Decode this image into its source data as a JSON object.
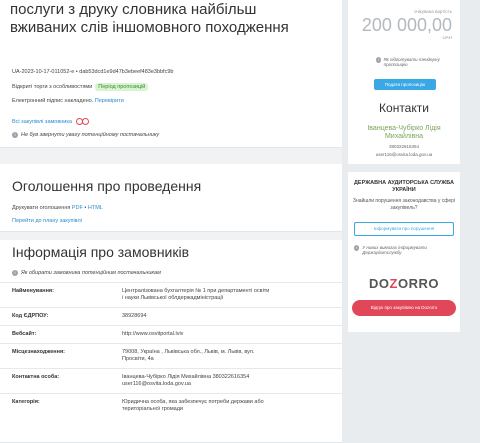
{
  "tender": {
    "title": "послуги з друку словника найбільш вживаних слів іншомовного походження",
    "id_line": "UA-2023-10-17-011052-e • dab53dcd1e9d47b3ebeef483e3bbfc9b",
    "open_text": "Відкриті торги з особливостями",
    "status_tag": "Період пропозицій",
    "signature_text": "Електронний підпис накладено.",
    "signature_link": "Перевірити",
    "all_procurements": "Всі закупівлі замовника",
    "warning": "Не був звернути увагу потенційному постачальнику"
  },
  "announcement": {
    "heading": "Оголошення про проведення",
    "print_prefix": "Друкувати оголошення",
    "print_pdf": "PDF",
    "print_sep": "•",
    "print_html": "HTML",
    "plan_link": "Перейти до плану закупівлі"
  },
  "customer": {
    "heading": "Інформація про замовників",
    "warning": "Як обирати замовника потенційним постачальникам",
    "rows": [
      {
        "key": "Найменування:",
        "value": "Централізована бухгалтерія № 1 при департаменті освіти і науки Львівської облдержадміністрації"
      },
      {
        "key": "Код ЄДРПОУ:",
        "value": "38928694"
      },
      {
        "key": "Вебсайт:",
        "value": "http://www.osvitportal.lviv"
      },
      {
        "key": "Місцезнаходження:",
        "value": "79008, Україна , Львівська обл., Львів, м. Львів, вул. Просвіти, 4а"
      },
      {
        "key": "Контактна особа:",
        "value": "Іванцева-Чубірко Лідія Михайлівна 380322616354 user116@osvita.loda.gov.ua"
      },
      {
        "key": "Категорія:",
        "value": "Юридична особа, яка забезпечує потреби держави або територіальної громади"
      }
    ]
  },
  "side": {
    "expected_label": "очікувана вартість",
    "amount": "200 000,00",
    "currency": "UAH",
    "not_ready": "Як підготувати тендерну пропозицію",
    "submit_button": "Подати пропозицію",
    "contacts_heading": "Контакти",
    "contact_name": "Іванцева-Чубірко Лідія Михайлівна",
    "contact_phone": "380322616354",
    "contact_email": "user116@osvita.loda.gov.ua",
    "audit_heading": "ДЕРЖАВНА АУДИТОРСЬКА СЛУЖБА УКРАЇНИ",
    "audit_text": "Знайшли порушення законодавства у сфері закупівель?",
    "report_button": "Інформувати про порушення",
    "no_documents": "У нових вимогах інформувати Держаудитслужбу",
    "dozorro_a": "DO",
    "dozorro_b": "Z",
    "dozorro_c": "O",
    "dozorro_d": "RRO",
    "review_button": "Відгук про закупівлю на Dozorro"
  },
  "colors": {
    "accent_blue": "#3aa8e4",
    "accent_red": "#e0485a",
    "tag_green": "#3c8a2e",
    "contact_green": "#7aa55a"
  }
}
